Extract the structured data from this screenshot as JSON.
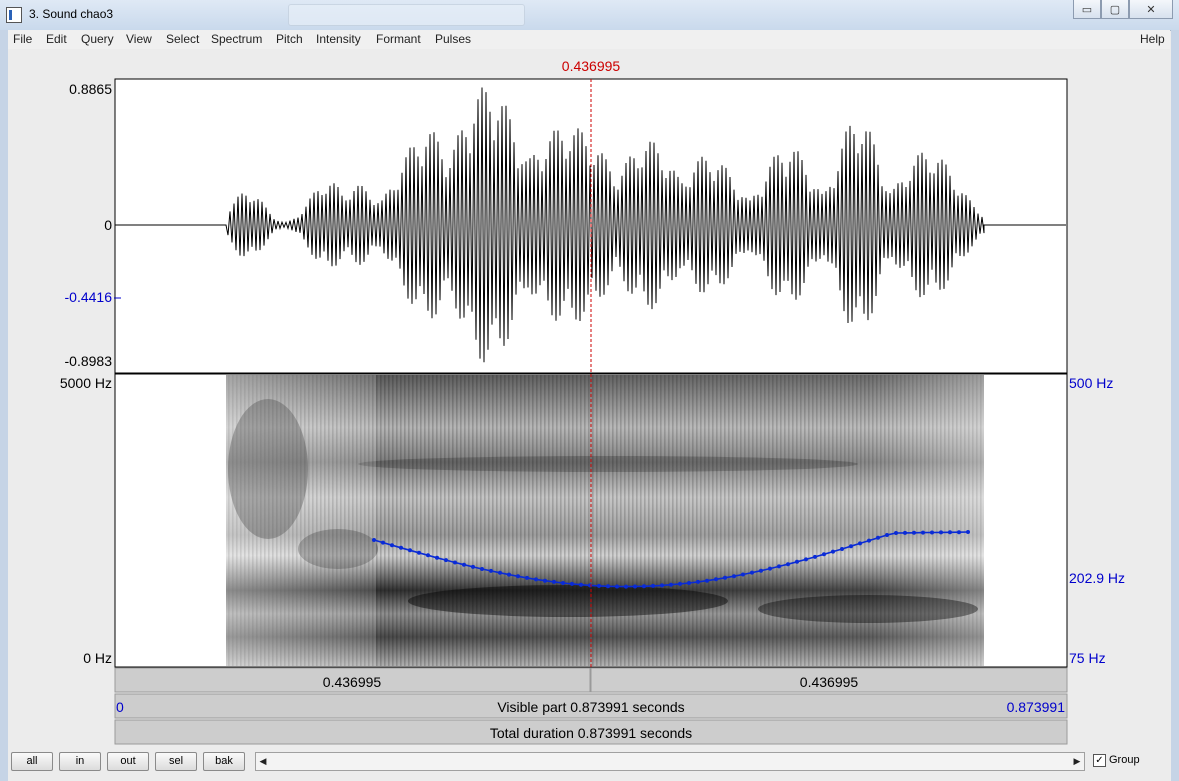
{
  "window": {
    "title": "3. Sound chao3",
    "minimize": "▭",
    "maximize": "▢",
    "close": "✕"
  },
  "menu": [
    "File",
    "Edit",
    "Query",
    "View",
    "Select",
    "Spectrum",
    "Pitch",
    "Intensity",
    "Formant",
    "Pulses"
  ],
  "help": "Help",
  "cursor_time": "0.436995",
  "waveform": {
    "ymax": "0.8865",
    "zero": "0",
    "cursor_value": "-0.4416",
    "ymin": "-0.8983"
  },
  "spectrogram": {
    "fmax": "5000 Hz",
    "fmin": "0 Hz",
    "pitch_max": "500 Hz",
    "pitch_cursor": "202.9 Hz",
    "pitch_min": "75 Hz"
  },
  "time_bars": {
    "left_segment": "0.436995",
    "right_segment": "0.436995",
    "visible_start": "0",
    "visible_label": "Visible part 0.873991 seconds",
    "visible_end": "0.873991",
    "total_label": "Total duration 0.873991 seconds"
  },
  "buttons": {
    "all": "all",
    "in": "in",
    "out": "out",
    "sel": "sel",
    "bak": "bak"
  },
  "scroll": {
    "left": "◀",
    "right": "▶"
  },
  "group": {
    "label": "Group",
    "check": "✓"
  },
  "colors": {
    "cursor": "#cc0000",
    "pitch": "#0000cc",
    "blue_label": "#0000cc"
  }
}
